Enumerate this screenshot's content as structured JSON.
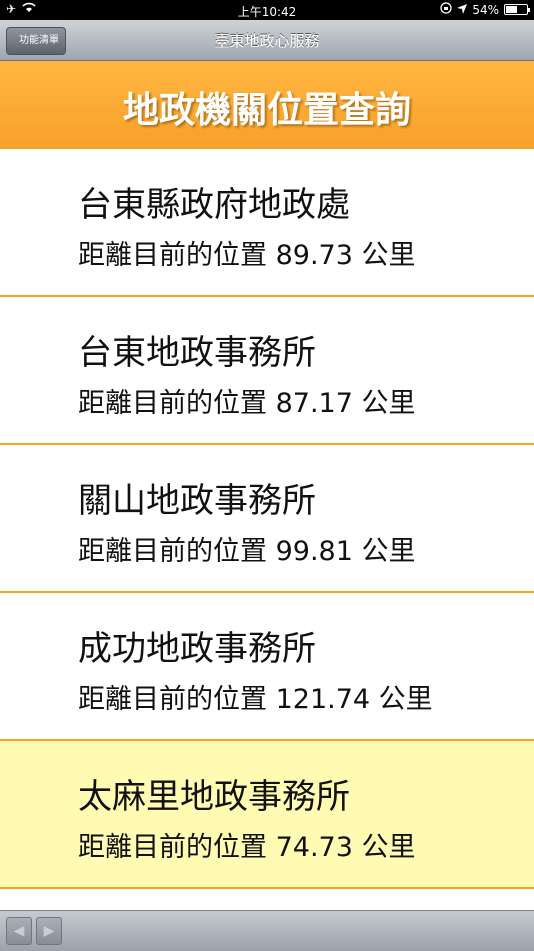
{
  "status_bar": {
    "time": "上午10:42",
    "battery": "54%",
    "battery_level": 0.54
  },
  "nav": {
    "back_label": "功能清單",
    "title": "臺東地政心服務"
  },
  "header": {
    "title": "地政機關位置查詢"
  },
  "offices": [
    {
      "name": "台東縣政府地政處",
      "distance": "距離目前的位置 89.73 公里"
    },
    {
      "name": "台東地政事務所",
      "distance": "距離目前的位置 87.17 公里"
    },
    {
      "name": "關山地政事務所",
      "distance": "距離目前的位置 99.81 公里"
    },
    {
      "name": "成功地政事務所",
      "distance": "距離目前的位置 121.74 公里"
    },
    {
      "name": "太麻里地政事務所",
      "distance": "距離目前的位置 74.73 公里",
      "selected": true
    }
  ],
  "icons": {
    "airplane": "airplane-icon",
    "wifi": "wifi-icon",
    "lock": "rotation-lock-icon",
    "location": "location-arrow-icon"
  },
  "colors": {
    "accent": "#f7a12b",
    "selected_row": "#fffbb3",
    "divider": "#f5a623"
  }
}
